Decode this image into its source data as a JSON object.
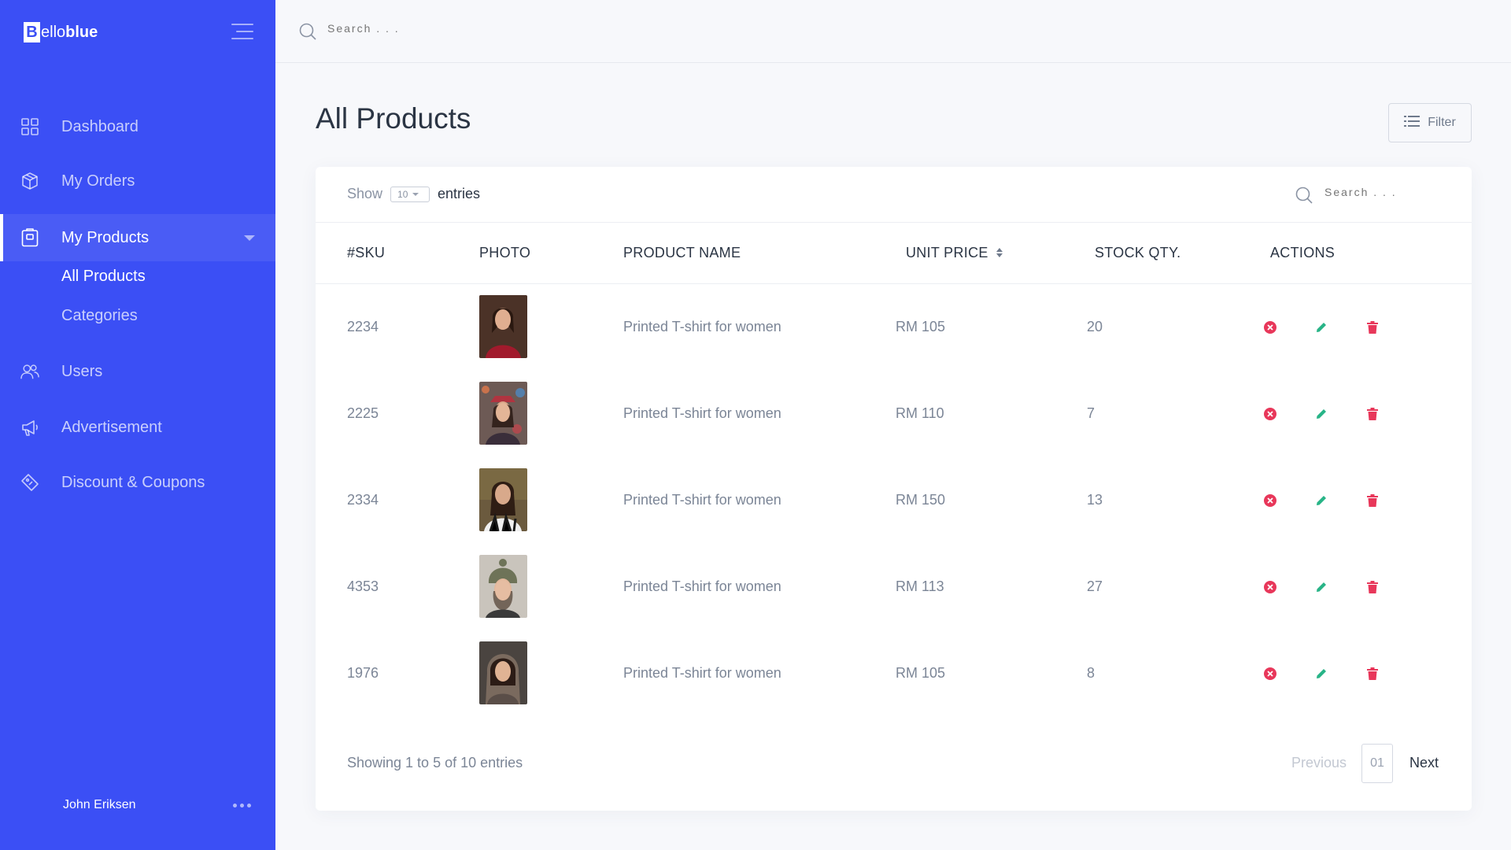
{
  "brand": {
    "letter": "B",
    "light": "ello",
    "bold": "blue"
  },
  "sidebar": {
    "items": [
      {
        "label": "Dashboard",
        "icon": "grid-icon"
      },
      {
        "label": "My Orders",
        "icon": "box-icon"
      },
      {
        "label": "My Products",
        "icon": "tag-box-icon",
        "active": true,
        "expanded": true
      },
      {
        "label": "Users",
        "icon": "users-icon"
      },
      {
        "label": "Advertisement",
        "icon": "megaphone-icon"
      },
      {
        "label": "Discount & Coupons",
        "icon": "coupon-icon"
      }
    ],
    "subitems": [
      {
        "label": "All Products",
        "active": true
      },
      {
        "label": "Categories",
        "active": false
      }
    ],
    "user": {
      "name": "John Eriksen"
    }
  },
  "topbar": {
    "search_placeholder": "Search . . ."
  },
  "page": {
    "title": "All Products",
    "filter_label": "Filter"
  },
  "table": {
    "show_label": "Show",
    "entries_value": "10",
    "entries_label": "entries",
    "search_placeholder": "Search . . .",
    "columns": [
      "#SKU",
      "PHOTO",
      "PRODUCT NAME",
      "UNIT PRICE",
      "STOCK QTY.",
      "ACTIONS"
    ],
    "rows": [
      {
        "sku": "2234",
        "name": "Printed T-shirt for women",
        "price": "RM 105",
        "stock": "20"
      },
      {
        "sku": "2225",
        "name": "Printed T-shirt for women",
        "price": "RM 110",
        "stock": "7"
      },
      {
        "sku": "2334",
        "name": "Printed T-shirt for women",
        "price": "RM 150",
        "stock": "13"
      },
      {
        "sku": "4353",
        "name": "Printed T-shirt for women",
        "price": "RM 113",
        "stock": "27"
      },
      {
        "sku": "1976",
        "name": "Printed T-shirt for women",
        "price": "RM 105",
        "stock": "8"
      }
    ],
    "footer": {
      "info": "Showing 1 to 5 of 10 entries",
      "prev": "Previous",
      "page": "01",
      "next": "Next"
    }
  },
  "colors": {
    "brand": "#3b4ff5",
    "cancel": "#e8375a",
    "edit": "#28b487",
    "delete": "#e8375a"
  }
}
